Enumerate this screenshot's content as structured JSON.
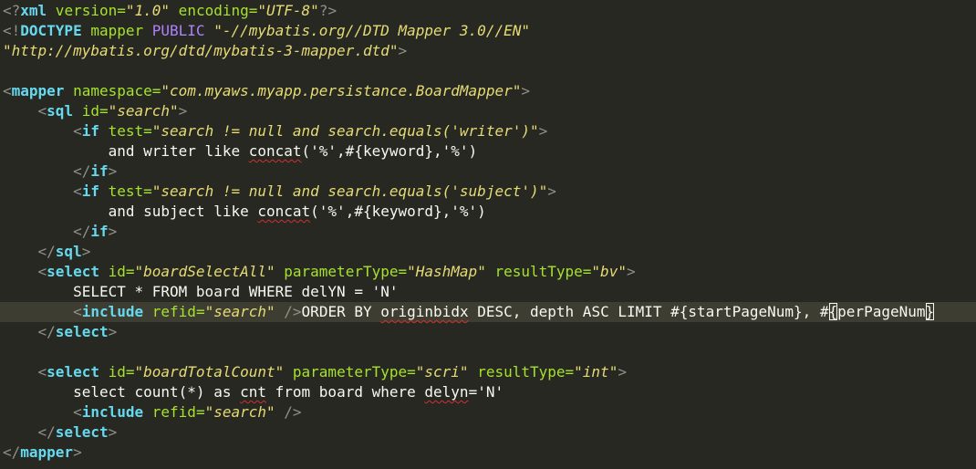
{
  "colors": {
    "background": "#272822",
    "current_line": "#3E3D32",
    "bracket": "#8F908A",
    "tag": "#66D9EF",
    "attribute": "#A6E22E",
    "string": "#E6DB74",
    "doctype_keyword": "#AE81FF",
    "text": "#F8F8F2",
    "spell_error": "#D03030"
  },
  "editor": {
    "current_line_index": 15,
    "lines": [
      [
        [
          "b",
          "<?"
        ],
        [
          "g",
          "xml"
        ],
        [
          "a",
          " version="
        ],
        [
          "s",
          "\"1.0\""
        ],
        [
          "a",
          " encoding="
        ],
        [
          "s",
          "\"UTF-8\""
        ],
        [
          "b",
          "?>"
        ]
      ],
      [
        [
          "b",
          "<!"
        ],
        [
          "g",
          "DOCTYPE"
        ],
        [
          "a",
          " mapper "
        ],
        [
          "k",
          "PUBLIC"
        ],
        [
          "s",
          " \"-//mybatis.org//DTD Mapper 3.0//EN\""
        ]
      ],
      [
        [
          "s",
          "\"http://mybatis.org/dtd/mybatis-3-mapper.dtd\""
        ],
        [
          "b",
          ">"
        ]
      ],
      [],
      [
        [
          "b",
          "<"
        ],
        [
          "g",
          "mapper"
        ],
        [
          "a",
          " namespace="
        ],
        [
          "s",
          "\"com.myaws.myapp.persistance.BoardMapper\""
        ],
        [
          "b",
          ">"
        ]
      ],
      [
        [
          "t",
          "    "
        ],
        [
          "b",
          "<"
        ],
        [
          "g",
          "sql"
        ],
        [
          "a",
          " id="
        ],
        [
          "s",
          "\"search\""
        ],
        [
          "b",
          ">"
        ]
      ],
      [
        [
          "t",
          "        "
        ],
        [
          "b",
          "<"
        ],
        [
          "g",
          "if"
        ],
        [
          "a",
          " test="
        ],
        [
          "s",
          "\"search != null and search.equals('writer')\""
        ],
        [
          "b",
          ">"
        ]
      ],
      [
        [
          "t",
          "            and writer like "
        ],
        [
          "u",
          "concat"
        ],
        [
          "t",
          "('%',#{keyword},'%')"
        ]
      ],
      [
        [
          "t",
          "        "
        ],
        [
          "b",
          "</"
        ],
        [
          "g",
          "if"
        ],
        [
          "b",
          ">"
        ]
      ],
      [
        [
          "t",
          "        "
        ],
        [
          "b",
          "<"
        ],
        [
          "g",
          "if"
        ],
        [
          "a",
          " test="
        ],
        [
          "s",
          "\"search != null and search.equals('subject')\""
        ],
        [
          "b",
          ">"
        ]
      ],
      [
        [
          "t",
          "            and subject like "
        ],
        [
          "u",
          "concat"
        ],
        [
          "t",
          "('%',#{keyword},'%')"
        ]
      ],
      [
        [
          "t",
          "        "
        ],
        [
          "b",
          "</"
        ],
        [
          "g",
          "if"
        ],
        [
          "b",
          ">"
        ]
      ],
      [
        [
          "t",
          "    "
        ],
        [
          "b",
          "</"
        ],
        [
          "g",
          "sql"
        ],
        [
          "b",
          ">"
        ]
      ],
      [
        [
          "t",
          "    "
        ],
        [
          "b",
          "<"
        ],
        [
          "g",
          "select"
        ],
        [
          "a",
          " id="
        ],
        [
          "s",
          "\"boardSelectAll\""
        ],
        [
          "a",
          " parameterType="
        ],
        [
          "s",
          "\"HashMap\""
        ],
        [
          "a",
          " resultType="
        ],
        [
          "s",
          "\"bv\""
        ],
        [
          "b",
          ">"
        ]
      ],
      [
        [
          "t",
          "        SELECT * FROM board WHERE delYN = 'N'"
        ]
      ],
      [
        [
          "t",
          "        "
        ],
        [
          "b",
          "<"
        ],
        [
          "g",
          "include"
        ],
        [
          "a",
          " refid="
        ],
        [
          "s",
          "\"search\""
        ],
        [
          "t",
          " "
        ],
        [
          "b",
          "/>"
        ],
        [
          "t",
          "ORDER BY "
        ],
        [
          "u",
          "originbidx"
        ],
        [
          "t",
          " DESC, depth ASC LIMIT #{startPageNum}, #"
        ],
        [
          "c",
          "{"
        ],
        [
          "t",
          "perPageNum"
        ],
        [
          "c",
          "}"
        ]
      ],
      [
        [
          "t",
          "    "
        ],
        [
          "b",
          "</"
        ],
        [
          "g",
          "select"
        ],
        [
          "b",
          ">"
        ]
      ],
      [],
      [
        [
          "t",
          "    "
        ],
        [
          "b",
          "<"
        ],
        [
          "g",
          "select"
        ],
        [
          "a",
          " id="
        ],
        [
          "s",
          "\"boardTotalCount\""
        ],
        [
          "a",
          " parameterType="
        ],
        [
          "s",
          "\"scri\""
        ],
        [
          "a",
          " resultType="
        ],
        [
          "s",
          "\"int\""
        ],
        [
          "b",
          ">"
        ]
      ],
      [
        [
          "t",
          "        select count(*) as "
        ],
        [
          "u",
          "cnt"
        ],
        [
          "t",
          " from board where "
        ],
        [
          "u",
          "delyn"
        ],
        [
          "t",
          "='N'"
        ]
      ],
      [
        [
          "t",
          "        "
        ],
        [
          "b",
          "<"
        ],
        [
          "g",
          "include"
        ],
        [
          "a",
          " refid="
        ],
        [
          "s",
          "\"search\""
        ],
        [
          "t",
          " "
        ],
        [
          "b",
          "/>"
        ]
      ],
      [
        [
          "t",
          "    "
        ],
        [
          "b",
          "</"
        ],
        [
          "g",
          "select"
        ],
        [
          "b",
          ">"
        ]
      ],
      [
        [
          "b",
          "</"
        ],
        [
          "g",
          "mapper"
        ],
        [
          "b",
          ">"
        ]
      ]
    ]
  }
}
